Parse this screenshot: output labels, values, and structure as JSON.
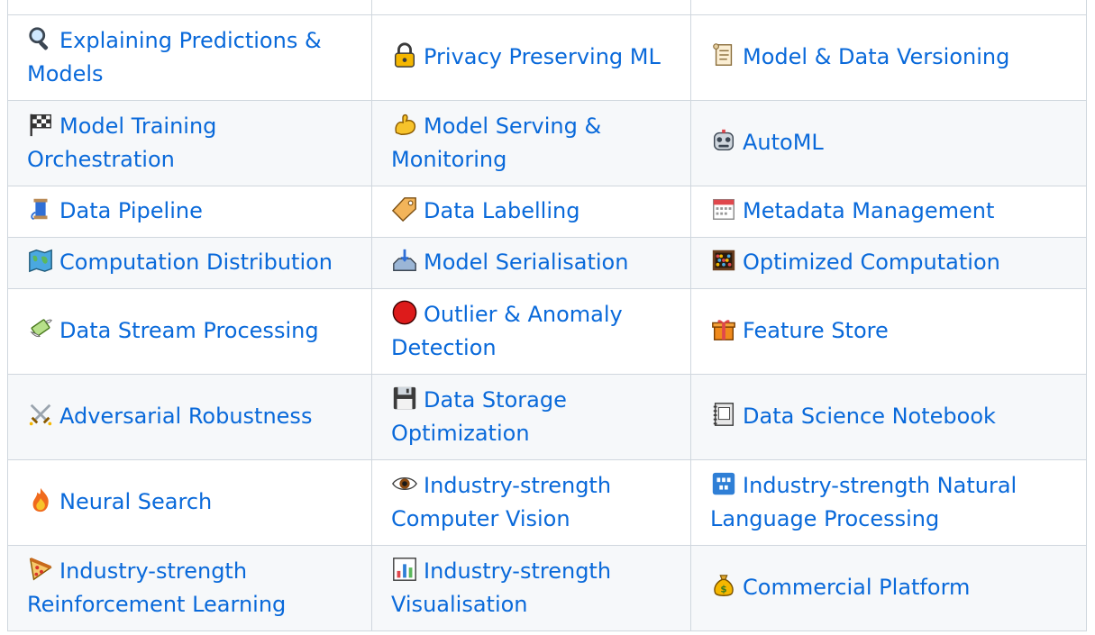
{
  "table": {
    "rows": [
      [
        {
          "icon": "magnifying-glass-icon",
          "label": "Explaining Predictions & Models"
        },
        {
          "icon": "lock-icon",
          "label": "Privacy Preserving ML"
        },
        {
          "icon": "scroll-icon",
          "label": "Model & Data Versioning"
        }
      ],
      [
        {
          "icon": "checkered-flag-icon",
          "label": "Model Training Orchestration"
        },
        {
          "icon": "flexed-biceps-icon",
          "label": "Model Serving & Monitoring"
        },
        {
          "icon": "robot-icon",
          "label": "AutoML"
        }
      ],
      [
        {
          "icon": "thread-spool-icon",
          "label": "Data Pipeline"
        },
        {
          "icon": "label-tag-icon",
          "label": "Data Labelling"
        },
        {
          "icon": "calendar-icon",
          "label": "Metadata Management"
        }
      ],
      [
        {
          "icon": "world-map-icon",
          "label": "Computation Distribution"
        },
        {
          "icon": "inbox-tray-icon",
          "label": "Model Serialisation"
        },
        {
          "icon": "abacus-icon",
          "label": "Optimized Computation"
        }
      ],
      [
        {
          "icon": "money-with-wings-icon",
          "label": "Data Stream Processing"
        },
        {
          "icon": "red-circle-icon",
          "label": "Outlier & Anomaly Detection"
        },
        {
          "icon": "gift-icon",
          "label": "Feature Store"
        }
      ],
      [
        {
          "icon": "crossed-swords-icon",
          "label": "Adversarial Robustness"
        },
        {
          "icon": "floppy-disk-icon",
          "label": "Data Storage Optimization"
        },
        {
          "icon": "notebook-icon",
          "label": "Data Science Notebook"
        }
      ],
      [
        {
          "icon": "fire-icon",
          "label": "Neural Search"
        },
        {
          "icon": "eye-icon",
          "label": "Industry-strength Computer Vision"
        },
        {
          "icon": "abcd-input-icon",
          "label": "Industry-strength Natural Language Processing"
        }
      ],
      [
        {
          "icon": "pizza-icon",
          "label": "Industry-strength Reinforcement Learning"
        },
        {
          "icon": "bar-chart-icon",
          "label": "Industry-strength Visualisation"
        },
        {
          "icon": "money-bag-icon",
          "label": "Commercial Platform"
        }
      ]
    ]
  },
  "colors": {
    "link": "#0969da",
    "border": "#d0d7de",
    "alt_row_bg": "#f6f8fa"
  }
}
